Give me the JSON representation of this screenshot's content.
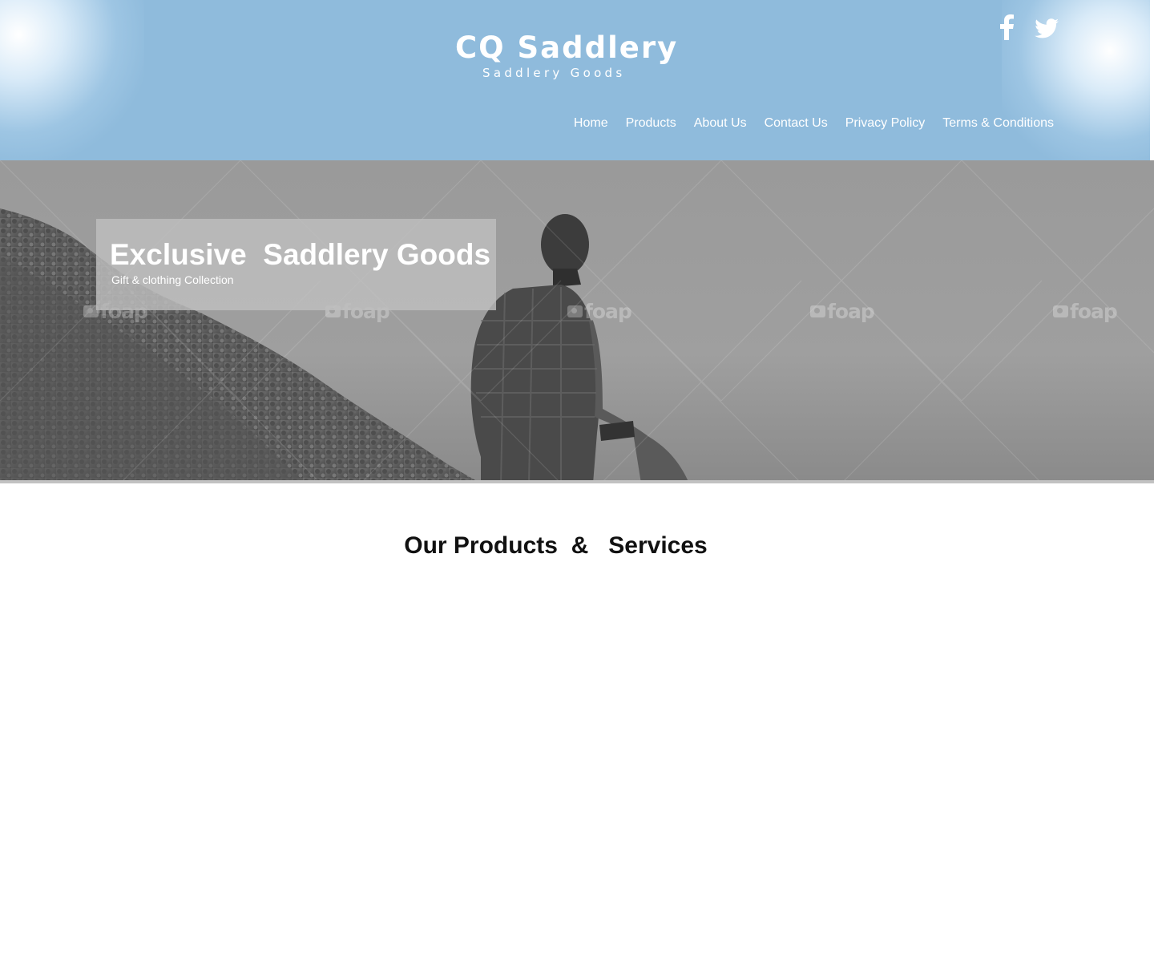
{
  "brand": {
    "title": "CQ Saddlery",
    "subtitle": "Saddlery Goods"
  },
  "social": [
    {
      "name": "facebook",
      "icon": "facebook-icon"
    },
    {
      "name": "twitter",
      "icon": "twitter-icon"
    }
  ],
  "nav": {
    "items": [
      {
        "label": "Home"
      },
      {
        "label": "Products"
      },
      {
        "label": "About Us"
      },
      {
        "label": "Contact Us"
      },
      {
        "label": "Privacy Policy"
      },
      {
        "label": "Terms & Conditions"
      }
    ]
  },
  "hero": {
    "title": "Exclusive  Saddlery Goods",
    "subtitle": "Gift & clothing Collection",
    "watermark": "foap"
  },
  "section": {
    "title": "Our Products  &   Services"
  },
  "colors": {
    "header_bg": "#8fbbdc",
    "hero_bg": "#9d9d9d",
    "text_light": "#ffffff",
    "text_dark": "#111111"
  }
}
